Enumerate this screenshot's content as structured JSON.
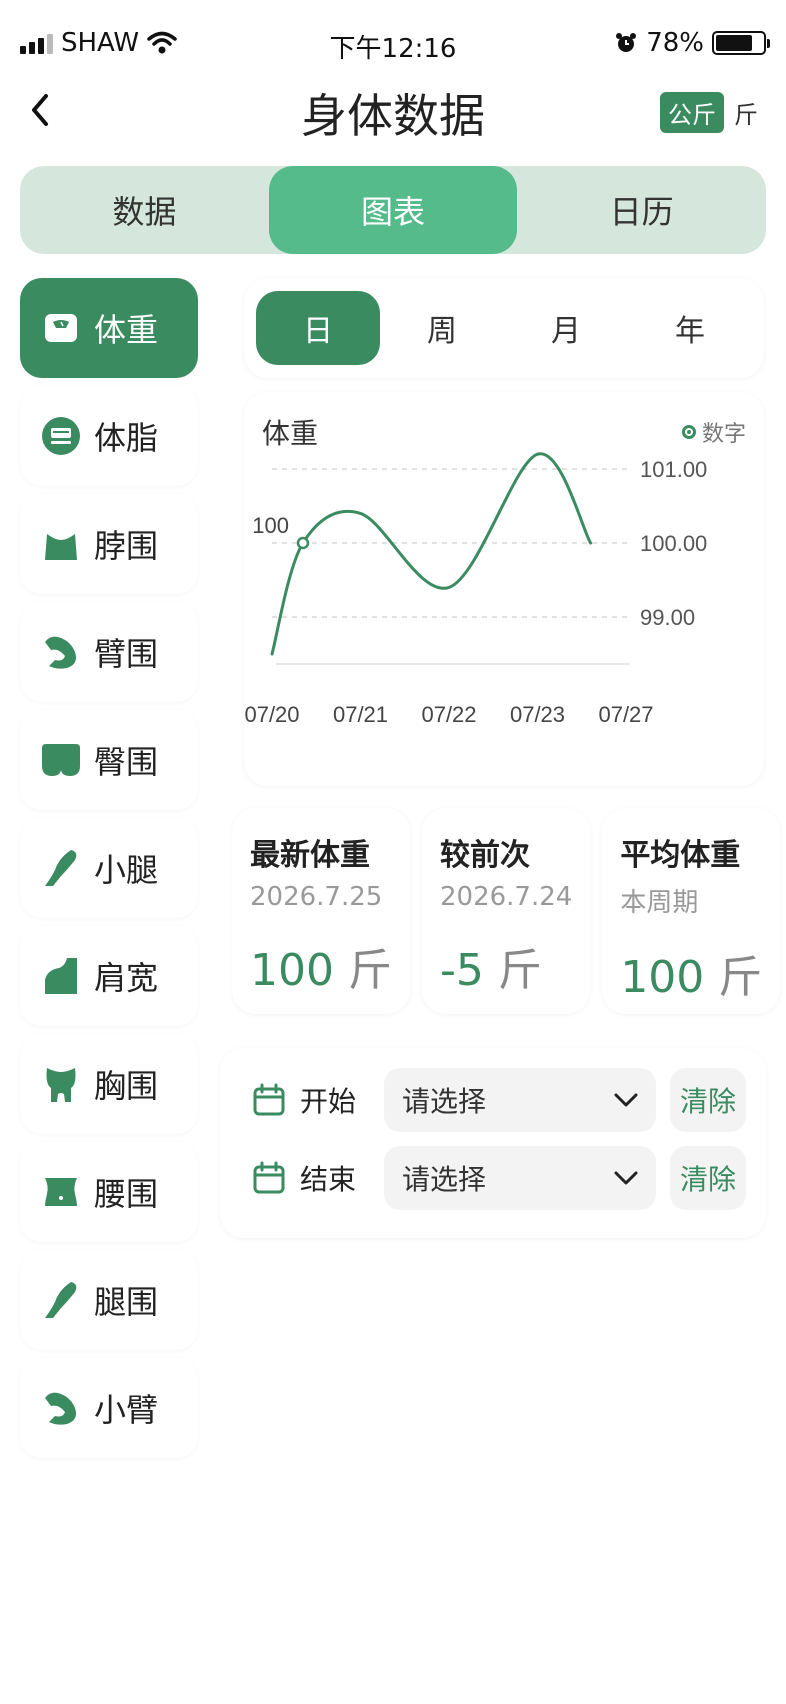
{
  "status_bar": {
    "carrier": "SHAW",
    "time": "下午12:16",
    "battery": "78%",
    "battery_level": 0.78,
    "icons": [
      "signal-icon",
      "wifi-icon",
      "alarm-icon",
      "battery-icon"
    ]
  },
  "nav": {
    "back_icon": "chevron-left-icon",
    "title": "身体数据",
    "unit_active": "公斤",
    "unit_inactive": "斤"
  },
  "main_tabs": [
    {
      "label": "数据",
      "active": false
    },
    {
      "label": "图表",
      "active": true
    },
    {
      "label": "日历",
      "active": false
    }
  ],
  "sidebar": {
    "items": [
      {
        "label": "体重",
        "icon": "scale-icon",
        "active": true
      },
      {
        "label": "体脂",
        "icon": "body-fat-scale-icon",
        "active": false
      },
      {
        "label": "脖围",
        "icon": "neck-icon",
        "active": false
      },
      {
        "label": "臂围",
        "icon": "arm-muscle-icon",
        "active": false
      },
      {
        "label": "臀围",
        "icon": "hip-icon",
        "active": false
      },
      {
        "label": "小腿",
        "icon": "calf-icon",
        "active": false
      },
      {
        "label": "肩宽",
        "icon": "shoulder-icon",
        "active": false
      },
      {
        "label": "胸围",
        "icon": "chest-icon",
        "active": false
      },
      {
        "label": "腰围",
        "icon": "waist-icon",
        "active": false
      },
      {
        "label": "腿围",
        "icon": "leg-icon",
        "active": false
      },
      {
        "label": "小臂",
        "icon": "forearm-icon",
        "active": false
      }
    ]
  },
  "period_tabs": [
    {
      "label": "日",
      "active": true
    },
    {
      "label": "周",
      "active": false
    },
    {
      "label": "月",
      "active": false
    },
    {
      "label": "年",
      "active": false
    }
  ],
  "chart_data": {
    "type": "line",
    "title": "体重",
    "legend": "数字",
    "legend_position": "top-right",
    "x_ticks": [
      "07/20",
      "07/21",
      "07/22",
      "07/23",
      "07/27"
    ],
    "y_ticks": [
      101.0,
      100.0,
      99.0
    ],
    "y_tick_labels": [
      "101.00",
      "100.00",
      "99.00"
    ],
    "ylim": [
      98.5,
      101.5
    ],
    "grid": "dashed horizontal at y ticks",
    "series": [
      {
        "color": "#3a8b5f",
        "x": [
          0,
          0.35,
          1.0,
          2.0,
          3.0,
          3.6
        ],
        "y": [
          98.5,
          100.0,
          100.4,
          99.4,
          101.2,
          100.0
        ]
      }
    ],
    "marker": {
      "x": 0.35,
      "y": 100.0,
      "label": "100"
    }
  },
  "stats": [
    {
      "title": "最新体重",
      "sub": "2026.7.25",
      "value": "100",
      "unit": "斤"
    },
    {
      "title": "较前次",
      "sub": "2026.7.24",
      "value": "-5",
      "unit": "斤"
    },
    {
      "title": "平均体重",
      "sub": "本周期",
      "value": "100",
      "unit": "斤"
    }
  ],
  "date_range": {
    "start_label": "开始",
    "end_label": "结束",
    "placeholder": "请选择",
    "clear_label": "清除"
  },
  "colors": {
    "primary": "#3a8b5f",
    "tab_active": "#56bb8a",
    "tab_bg": "#d5e7dc"
  }
}
